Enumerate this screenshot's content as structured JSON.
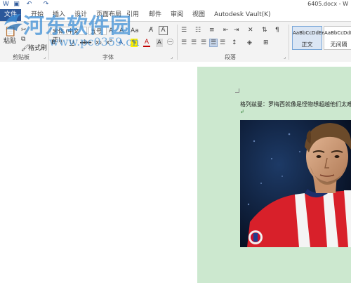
{
  "titlebar": {
    "document_title": "6405.docx - W"
  },
  "tabs": {
    "file": "文件",
    "items": [
      "开始",
      "插入",
      "设计",
      "页面布局",
      "引用",
      "邮件",
      "审阅",
      "视图",
      "Autodesk Vault(K)"
    ]
  },
  "ribbon": {
    "clipboard": {
      "paste": "粘贴",
      "format_painter": "格式刷",
      "label": "剪贴板"
    },
    "font": {
      "font_name": "宋体 (中文正)",
      "font_size": "五号",
      "label": "字体"
    },
    "paragraph": {
      "label": "段落"
    },
    "styles": {
      "items": [
        {
          "sample": "AaBbCcDdEe",
          "name": "正文"
        },
        {
          "sample": "AaBbCcDdEe",
          "name": "无间隔"
        }
      ]
    }
  },
  "document": {
    "body_text": "格列兹曼：罗梅西就像是怪物想超越他们太难了",
    "paragraph_mark": "↲"
  },
  "watermark": {
    "title": "河东软件园",
    "url": "www.pc0359.cn"
  },
  "colors": {
    "accent": "#2b579a",
    "page_background": "#cce8cf",
    "watermark": "#3e8fd6"
  }
}
